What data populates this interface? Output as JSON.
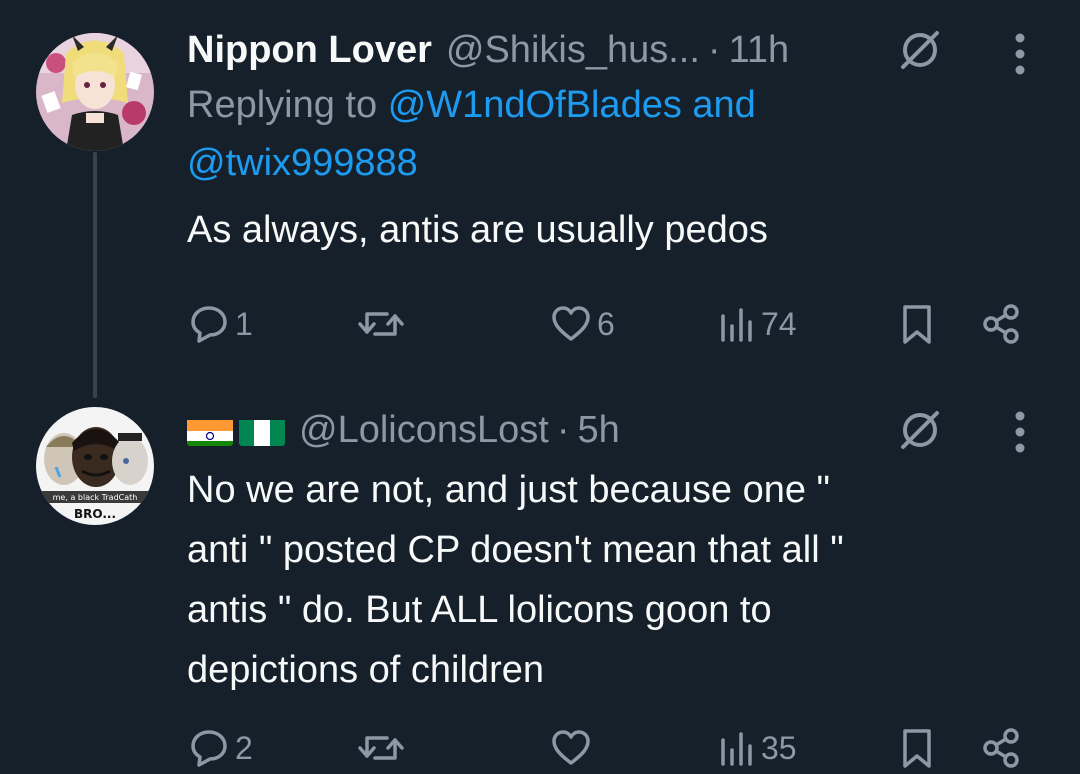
{
  "tweets": [
    {
      "display_name": "Nippon Lover",
      "handle": "@Shikis_hus...",
      "separator": "·",
      "time": "11h",
      "reply_prefix": "Replying to",
      "reply_mention_1": "@W1ndOfBlades",
      "reply_and": "and",
      "reply_mention_2": "@twix999888",
      "text": "As always, antis are usually pedos",
      "reply_count": "1",
      "retweet_count": "",
      "like_count": "6",
      "views_count": "74",
      "avatar_icon": "anime-girl-avatar"
    },
    {
      "flags": [
        "india-flag",
        "nigeria-flag"
      ],
      "handle": "@LoliconsLost",
      "separator": "·",
      "time": "5h",
      "text_lines": [
        "No we are not, and just because one \"",
        "anti \" posted CP doesn't mean that all \"",
        "antis \" do. But ALL lolicons goon to",
        "depictions of children"
      ],
      "avatar_caption_top": "me, a black TradCath",
      "avatar_caption_bottom": "BRO...",
      "reply_count": "2",
      "retweet_count": "",
      "like_count": "",
      "views_count": "35",
      "avatar_icon": "meme-avatar"
    }
  ],
  "icons": {
    "grok": "grok-icon",
    "more": "more-icon",
    "reply": "reply-icon",
    "retweet": "retweet-icon",
    "like": "like-icon",
    "views": "views-icon",
    "bookmark": "bookmark-icon",
    "share": "share-icon"
  },
  "colors": {
    "background": "#15202b",
    "text_primary": "#f7f9f9",
    "text_secondary": "#8b98a5",
    "link": "#1d9bf0",
    "thread_line": "#38444d"
  }
}
